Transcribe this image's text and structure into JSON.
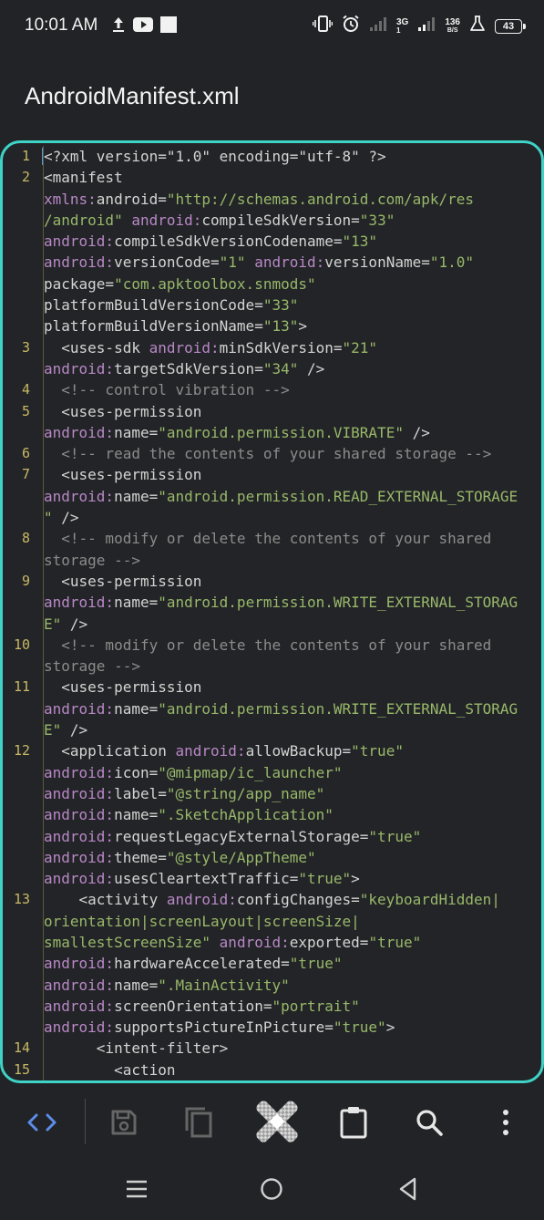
{
  "status_bar": {
    "time": "10:01 AM",
    "net_type_top": "3G",
    "net_type_bottom": "1",
    "net_speed": "136",
    "net_speed_unit": "B/S",
    "battery": "43"
  },
  "title": "AndroidManifest.xml",
  "colors": {
    "accent_border": "#3fd3c7",
    "toolbar_active": "#5b8de8",
    "background": "#222326"
  },
  "code_lines": [
    {
      "num": "1",
      "rows": [
        [
          [
            "t-text",
            "<?xml version=\"1.0\" encoding=\"utf-8\" ?>"
          ]
        ]
      ]
    },
    {
      "num": "2",
      "rows": [
        [
          [
            "t-text",
            "<manifest"
          ]
        ],
        [
          [
            "t-ns",
            "xmlns:"
          ],
          [
            "t-text",
            "android="
          ],
          [
            "t-str",
            "\"http://schemas.android.com/apk/res"
          ]
        ],
        [
          [
            "t-str",
            "/android\""
          ],
          [
            "t-text",
            " "
          ],
          [
            "t-ns",
            "android:"
          ],
          [
            "t-text",
            "compileSdkVersion="
          ],
          [
            "t-str",
            "\"33\""
          ]
        ],
        [
          [
            "t-ns",
            "android:"
          ],
          [
            "t-text",
            "compileSdkVersionCodename="
          ],
          [
            "t-str",
            "\"13\""
          ]
        ],
        [
          [
            "t-ns",
            "android:"
          ],
          [
            "t-text",
            "versionCode="
          ],
          [
            "t-str",
            "\"1\""
          ],
          [
            "t-text",
            " "
          ],
          [
            "t-ns",
            "android:"
          ],
          [
            "t-text",
            "versionName="
          ],
          [
            "t-str",
            "\"1.0\""
          ]
        ],
        [
          [
            "t-text",
            "package="
          ],
          [
            "t-str",
            "\"com.apktoolbox.snmods\""
          ]
        ],
        [
          [
            "t-text",
            "platformBuildVersionCode="
          ],
          [
            "t-str",
            "\"33\""
          ]
        ],
        [
          [
            "t-text",
            "platformBuildVersionName="
          ],
          [
            "t-str",
            "\"13\""
          ],
          [
            "t-text",
            ">"
          ]
        ]
      ]
    },
    {
      "num": "3",
      "rows": [
        [
          [
            "t-text",
            "  <uses-sdk "
          ],
          [
            "t-ns",
            "android:"
          ],
          [
            "t-text",
            "minSdkVersion="
          ],
          [
            "t-str",
            "\"21\""
          ]
        ],
        [
          [
            "t-ns",
            "android:"
          ],
          [
            "t-text",
            "targetSdkVersion="
          ],
          [
            "t-str",
            "\"34\""
          ],
          [
            "t-text",
            " />"
          ]
        ]
      ]
    },
    {
      "num": "4",
      "rows": [
        [
          [
            "t-com",
            "  <!-- control vibration -->"
          ]
        ]
      ]
    },
    {
      "num": "5",
      "rows": [
        [
          [
            "t-text",
            "  <uses-permission"
          ]
        ],
        [
          [
            "t-ns",
            "android:"
          ],
          [
            "t-text",
            "name="
          ],
          [
            "t-str",
            "\"android.permission.VIBRATE\""
          ],
          [
            "t-text",
            " />"
          ]
        ]
      ]
    },
    {
      "num": "6",
      "rows": [
        [
          [
            "t-com",
            "  <!-- read the contents of your shared storage -->"
          ]
        ]
      ]
    },
    {
      "num": "7",
      "rows": [
        [
          [
            "t-text",
            "  <uses-permission"
          ]
        ],
        [
          [
            "t-ns",
            "android:"
          ],
          [
            "t-text",
            "name="
          ],
          [
            "t-str",
            "\"android.permission.READ_EXTERNAL_STORAGE"
          ]
        ],
        [
          [
            "t-str",
            "\""
          ],
          [
            "t-text",
            " />"
          ]
        ]
      ]
    },
    {
      "num": "8",
      "rows": [
        [
          [
            "t-com",
            "  <!-- modify or delete the contents of your shared"
          ]
        ],
        [
          [
            "t-com",
            "storage -->"
          ]
        ]
      ]
    },
    {
      "num": "9",
      "rows": [
        [
          [
            "t-text",
            "  <uses-permission"
          ]
        ],
        [
          [
            "t-ns",
            "android:"
          ],
          [
            "t-text",
            "name="
          ],
          [
            "t-str",
            "\"android.permission.WRITE_EXTERNAL_STORAG"
          ]
        ],
        [
          [
            "t-str",
            "E\""
          ],
          [
            "t-text",
            " />"
          ]
        ]
      ]
    },
    {
      "num": "10",
      "rows": [
        [
          [
            "t-com",
            "  <!-- modify or delete the contents of your shared"
          ]
        ],
        [
          [
            "t-com",
            "storage -->"
          ]
        ]
      ]
    },
    {
      "num": "11",
      "rows": [
        [
          [
            "t-text",
            "  <uses-permission"
          ]
        ],
        [
          [
            "t-ns",
            "android:"
          ],
          [
            "t-text",
            "name="
          ],
          [
            "t-str",
            "\"android.permission.WRITE_EXTERNAL_STORAG"
          ]
        ],
        [
          [
            "t-str",
            "E\""
          ],
          [
            "t-text",
            " />"
          ]
        ]
      ]
    },
    {
      "num": "12",
      "rows": [
        [
          [
            "t-text",
            "  <application "
          ],
          [
            "t-ns",
            "android:"
          ],
          [
            "t-text",
            "allowBackup="
          ],
          [
            "t-str",
            "\"true\""
          ]
        ],
        [
          [
            "t-ns",
            "android:"
          ],
          [
            "t-text",
            "icon="
          ],
          [
            "t-str",
            "\"@mipmap/ic_launcher\""
          ]
        ],
        [
          [
            "t-ns",
            "android:"
          ],
          [
            "t-text",
            "label="
          ],
          [
            "t-str",
            "\"@string/app_name\""
          ]
        ],
        [
          [
            "t-ns",
            "android:"
          ],
          [
            "t-text",
            "name="
          ],
          [
            "t-str",
            "\".SketchApplication\""
          ]
        ],
        [
          [
            "t-ns",
            "android:"
          ],
          [
            "t-text",
            "requestLegacyExternalStorage="
          ],
          [
            "t-str",
            "\"true\""
          ]
        ],
        [
          [
            "t-ns",
            "android:"
          ],
          [
            "t-text",
            "theme="
          ],
          [
            "t-str",
            "\"@style/AppTheme\""
          ]
        ],
        [
          [
            "t-ns",
            "android:"
          ],
          [
            "t-text",
            "usesCleartextTraffic="
          ],
          [
            "t-str",
            "\"true\""
          ],
          [
            "t-text",
            ">"
          ]
        ]
      ]
    },
    {
      "num": "13",
      "rows": [
        [
          [
            "t-text",
            "    <activity "
          ],
          [
            "t-ns",
            "android:"
          ],
          [
            "t-text",
            "configChanges="
          ],
          [
            "t-str",
            "\"keyboardHidden|"
          ]
        ],
        [
          [
            "t-str",
            "orientation|screenLayout|screenSize|"
          ]
        ],
        [
          [
            "t-str",
            "smallestScreenSize\""
          ],
          [
            "t-text",
            " "
          ],
          [
            "t-ns",
            "android:"
          ],
          [
            "t-text",
            "exported="
          ],
          [
            "t-str",
            "\"true\""
          ]
        ],
        [
          [
            "t-ns",
            "android:"
          ],
          [
            "t-text",
            "hardwareAccelerated="
          ],
          [
            "t-str",
            "\"true\""
          ]
        ],
        [
          [
            "t-ns",
            "android:"
          ],
          [
            "t-text",
            "name="
          ],
          [
            "t-str",
            "\".MainActivity\""
          ]
        ],
        [
          [
            "t-ns",
            "android:"
          ],
          [
            "t-text",
            "screenOrientation="
          ],
          [
            "t-str",
            "\"portrait\""
          ]
        ],
        [
          [
            "t-ns",
            "android:"
          ],
          [
            "t-text",
            "supportsPictureInPicture="
          ],
          [
            "t-str",
            "\"true\""
          ],
          [
            "t-text",
            ">"
          ]
        ]
      ]
    },
    {
      "num": "14",
      "rows": [
        [
          [
            "t-text",
            "      <intent-filter>"
          ]
        ]
      ]
    },
    {
      "num": "15",
      "rows": [
        [
          [
            "t-text",
            "        <action"
          ]
        ]
      ]
    }
  ]
}
